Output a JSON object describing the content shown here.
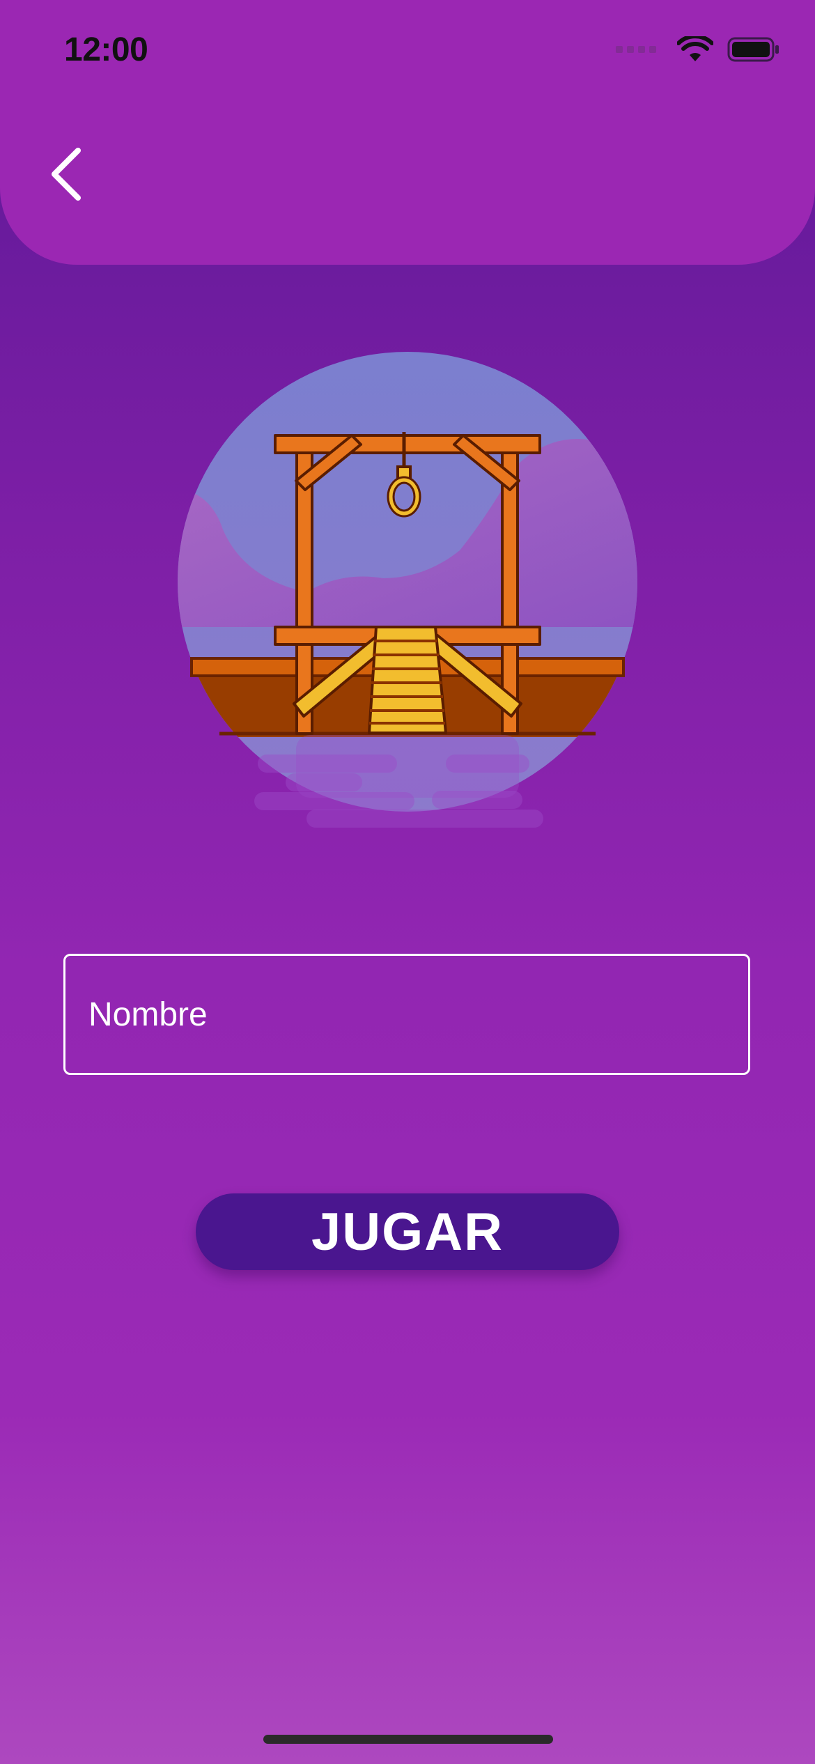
{
  "status_bar": {
    "time": "12:00",
    "icons": [
      "signal-icon",
      "wifi-icon",
      "battery-icon"
    ]
  },
  "header": {
    "back_icon": "chevron-left-icon"
  },
  "hero": {
    "image": "gallows-illustration"
  },
  "form": {
    "name_placeholder": "Nombre"
  },
  "actions": {
    "play_label": "JUGAR"
  },
  "colors": {
    "header_bg": "#9b27b3",
    "button_bg": "#4a168f",
    "background_top": "#5b1896",
    "background_bottom": "#ad48bf"
  }
}
